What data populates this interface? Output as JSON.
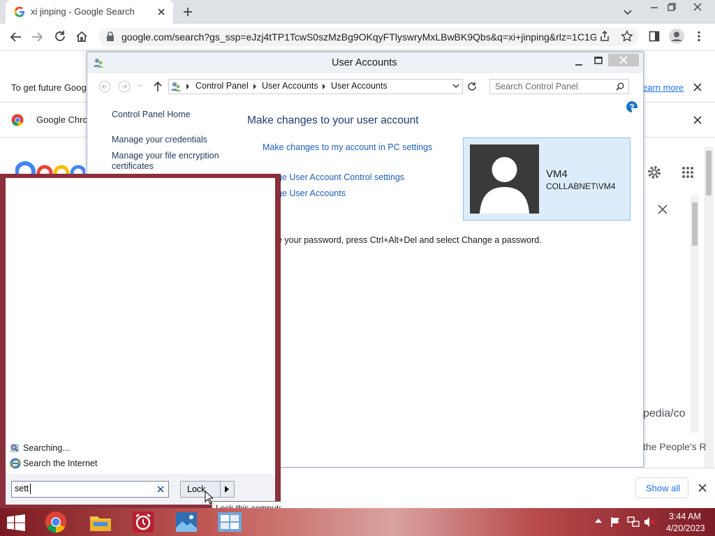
{
  "browser": {
    "tab_title": "xi jinping - Google Search",
    "url": "google.com/search?gs_ssp=eJzj4tTP1TcwS0szMzBg9OKqyFTlyswryMxLBwBK9Qbs&q=xi+jinping&rlz=1C1G...",
    "infobar1_text": "To get future Goog",
    "infobar1_link": "earn more",
    "infobar2_text": "Google Chro",
    "page_snippets": {
      "wiki": "pedia/co",
      "peoples": "the People's R"
    },
    "download_bar": {
      "show_all": "Show all"
    }
  },
  "control_panel": {
    "title": "User Accounts",
    "breadcrumb": [
      "Control Panel",
      "User Accounts",
      "User Accounts"
    ],
    "search_placeholder": "Search Control Panel",
    "left_nav": {
      "home": "Control Panel Home",
      "credentials": "Manage your credentials",
      "encryption_line1": "Manage your file encryption",
      "encryption_line2": "certificates"
    },
    "heading": "Make changes to your user account",
    "links": {
      "pc_settings": "Make changes to my account in PC settings",
      "uac": "ge User Account Control settings",
      "manage": "ge User Accounts"
    },
    "password_note": "e your password, press Ctrl+Alt+Del and select Change a password.",
    "user": {
      "name": "VM4",
      "domain": "COLLABNET\\VM4"
    }
  },
  "start_menu": {
    "searching": "Searching...",
    "search_internet": "Search the Internet",
    "search_value": "sett",
    "lock_label": "Lock",
    "tooltip": "Lock this computer."
  },
  "taskbar": {
    "time": "3:44 AM",
    "date": "4/20/2023"
  },
  "colors": {
    "start_border": "#8a2f3b",
    "link_blue": "#1c5fb8",
    "user_card_bg": "#dcecfa"
  }
}
